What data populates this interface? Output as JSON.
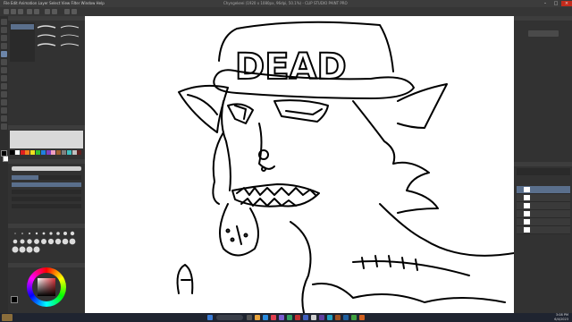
{
  "app": {
    "menu": "File  Edit  Animation  Layer  Select  View  Filter  Window  Help",
    "title": "Chyngekeei (1920 x 1080px, 96dpi, 50.1%) - CLIP STUDIO PAINT PRO"
  },
  "canvas": {
    "hat_text": "DEAD"
  },
  "colors": {
    "accent": "#e0343c",
    "swatches": [
      "#000000",
      "#ffffff",
      "#e02020",
      "#f08020",
      "#f0e020",
      "#30c030",
      "#2080e0",
      "#8040c0",
      "#f0a0c0",
      "#a06030",
      "#808080",
      "#40c0c0",
      "#c0c0c0",
      "#602020"
    ]
  },
  "taskbar": {
    "time": "3:08 PM",
    "date": "6/4/2023"
  }
}
